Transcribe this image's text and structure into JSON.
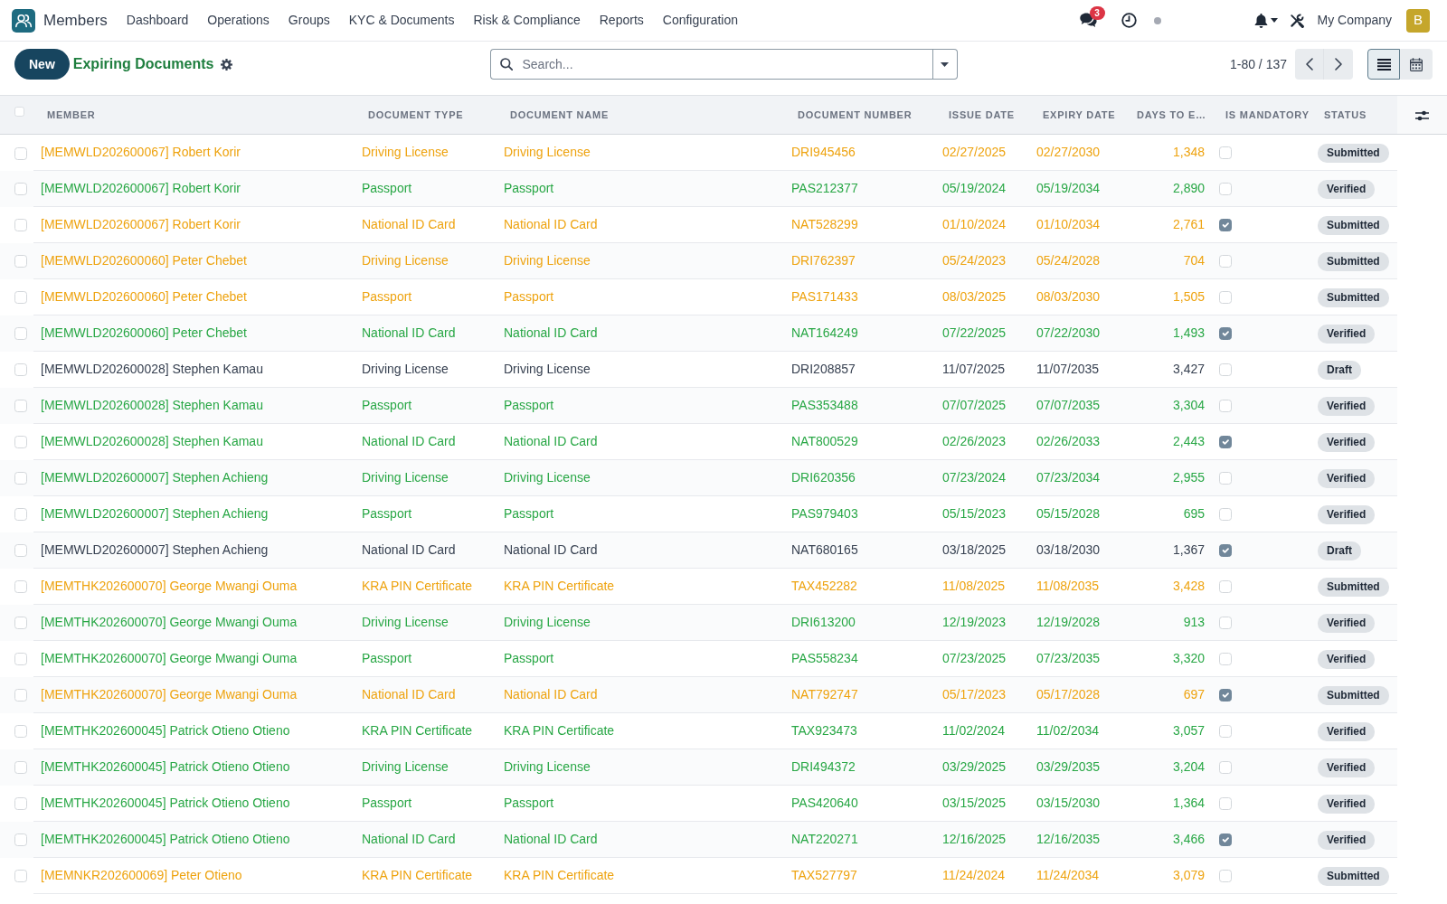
{
  "navbar": {
    "app_name": "Members",
    "menu": [
      "Dashboard",
      "Operations",
      "Groups",
      "KYC & Documents",
      "Risk & Compliance",
      "Reports",
      "Configuration"
    ],
    "unread_messages": "3",
    "company": "My Company",
    "avatar_initial": "B"
  },
  "control_panel": {
    "new_button": "New",
    "title": "Expiring Documents",
    "search": {
      "placeholder": "Search..."
    },
    "pager": "1-80 / 137",
    "views": [
      {
        "kind": "list",
        "selected": true
      },
      {
        "kind": "calendar",
        "selected": false
      }
    ]
  },
  "table": {
    "all_selected": false,
    "columns": [
      "MEMBER",
      "DOCUMENT TYPE",
      "DOCUMENT NAME",
      "DOCUMENT NUMBER",
      "ISSUE DATE",
      "EXPIRY DATE",
      "DAYS TO E…",
      "IS MANDATORY",
      "STATUS"
    ],
    "rows": [
      {
        "selected": false,
        "color": "#eea30f",
        "member": "[MEMWLD202600067] Robert Korir",
        "document_type": "Driving License",
        "document_name": "Driving License",
        "document_number": "DRI945456",
        "issue_date": "02/27/2025",
        "expiry_date": "02/27/2030",
        "days_to_expiry": "1,348",
        "is_mandatory": false,
        "status": "Submitted"
      },
      {
        "selected": false,
        "color": "#28a745",
        "member": "[MEMWLD202600067] Robert Korir",
        "document_type": "Passport",
        "document_name": "Passport",
        "document_number": "PAS212377",
        "issue_date": "05/19/2024",
        "expiry_date": "05/19/2034",
        "days_to_expiry": "2,890",
        "is_mandatory": false,
        "status": "Verified"
      },
      {
        "selected": false,
        "color": "#eea30f",
        "member": "[MEMWLD202600067] Robert Korir",
        "document_type": "National ID Card",
        "document_name": "National ID Card",
        "document_number": "NAT528299",
        "issue_date": "01/10/2024",
        "expiry_date": "01/10/2034",
        "days_to_expiry": "2,761",
        "is_mandatory": true,
        "status": "Submitted"
      },
      {
        "selected": false,
        "color": "#eea30f",
        "member": "[MEMWLD202600060] Peter Chebet",
        "document_type": "Driving License",
        "document_name": "Driving License",
        "document_number": "DRI762397",
        "issue_date": "05/24/2023",
        "expiry_date": "05/24/2028",
        "days_to_expiry": "704",
        "is_mandatory": false,
        "status": "Submitted"
      },
      {
        "selected": false,
        "color": "#eea30f",
        "member": "[MEMWLD202600060] Peter Chebet",
        "document_type": "Passport",
        "document_name": "Passport",
        "document_number": "PAS171433",
        "issue_date": "08/03/2025",
        "expiry_date": "08/03/2030",
        "days_to_expiry": "1,505",
        "is_mandatory": false,
        "status": "Submitted"
      },
      {
        "selected": false,
        "color": "#28a745",
        "member": "[MEMWLD202600060] Peter Chebet",
        "document_type": "National ID Card",
        "document_name": "National ID Card",
        "document_number": "NAT164249",
        "issue_date": "07/22/2025",
        "expiry_date": "07/22/2030",
        "days_to_expiry": "1,493",
        "is_mandatory": true,
        "status": "Verified"
      },
      {
        "selected": false,
        "color": "#374151",
        "member": "[MEMWLD202600028] Stephen Kamau",
        "document_type": "Driving License",
        "document_name": "Driving License",
        "document_number": "DRI208857",
        "issue_date": "11/07/2025",
        "expiry_date": "11/07/2035",
        "days_to_expiry": "3,427",
        "is_mandatory": false,
        "status": "Draft"
      },
      {
        "selected": false,
        "color": "#28a745",
        "member": "[MEMWLD202600028] Stephen Kamau",
        "document_type": "Passport",
        "document_name": "Passport",
        "document_number": "PAS353488",
        "issue_date": "07/07/2025",
        "expiry_date": "07/07/2035",
        "days_to_expiry": "3,304",
        "is_mandatory": false,
        "status": "Verified"
      },
      {
        "selected": false,
        "color": "#28a745",
        "member": "[MEMWLD202600028] Stephen Kamau",
        "document_type": "National ID Card",
        "document_name": "National ID Card",
        "document_number": "NAT800529",
        "issue_date": "02/26/2023",
        "expiry_date": "02/26/2033",
        "days_to_expiry": "2,443",
        "is_mandatory": true,
        "status": "Verified"
      },
      {
        "selected": false,
        "color": "#28a745",
        "member": "[MEMWLD202600007] Stephen Achieng",
        "document_type": "Driving License",
        "document_name": "Driving License",
        "document_number": "DRI620356",
        "issue_date": "07/23/2024",
        "expiry_date": "07/23/2034",
        "days_to_expiry": "2,955",
        "is_mandatory": false,
        "status": "Verified"
      },
      {
        "selected": false,
        "color": "#28a745",
        "member": "[MEMWLD202600007] Stephen Achieng",
        "document_type": "Passport",
        "document_name": "Passport",
        "document_number": "PAS979403",
        "issue_date": "05/15/2023",
        "expiry_date": "05/15/2028",
        "days_to_expiry": "695",
        "is_mandatory": false,
        "status": "Verified"
      },
      {
        "selected": false,
        "color": "#374151",
        "member": "[MEMWLD202600007] Stephen Achieng",
        "document_type": "National ID Card",
        "document_name": "National ID Card",
        "document_number": "NAT680165",
        "issue_date": "03/18/2025",
        "expiry_date": "03/18/2030",
        "days_to_expiry": "1,367",
        "is_mandatory": true,
        "status": "Draft"
      },
      {
        "selected": false,
        "color": "#eea30f",
        "member": "[MEMTHK202600070] George Mwangi Ouma",
        "document_type": "KRA PIN Certificate",
        "document_name": "KRA PIN Certificate",
        "document_number": "TAX452282",
        "issue_date": "11/08/2025",
        "expiry_date": "11/08/2035",
        "days_to_expiry": "3,428",
        "is_mandatory": false,
        "status": "Submitted"
      },
      {
        "selected": false,
        "color": "#28a745",
        "member": "[MEMTHK202600070] George Mwangi Ouma",
        "document_type": "Driving License",
        "document_name": "Driving License",
        "document_number": "DRI613200",
        "issue_date": "12/19/2023",
        "expiry_date": "12/19/2028",
        "days_to_expiry": "913",
        "is_mandatory": false,
        "status": "Verified"
      },
      {
        "selected": false,
        "color": "#28a745",
        "member": "[MEMTHK202600070] George Mwangi Ouma",
        "document_type": "Passport",
        "document_name": "Passport",
        "document_number": "PAS558234",
        "issue_date": "07/23/2025",
        "expiry_date": "07/23/2035",
        "days_to_expiry": "3,320",
        "is_mandatory": false,
        "status": "Verified"
      },
      {
        "selected": false,
        "color": "#eea30f",
        "member": "[MEMTHK202600070] George Mwangi Ouma",
        "document_type": "National ID Card",
        "document_name": "National ID Card",
        "document_number": "NAT792747",
        "issue_date": "05/17/2023",
        "expiry_date": "05/17/2028",
        "days_to_expiry": "697",
        "is_mandatory": true,
        "status": "Submitted"
      },
      {
        "selected": false,
        "color": "#28a745",
        "member": "[MEMTHK202600045] Patrick Otieno Otieno",
        "document_type": "KRA PIN Certificate",
        "document_name": "KRA PIN Certificate",
        "document_number": "TAX923473",
        "issue_date": "11/02/2024",
        "expiry_date": "11/02/2034",
        "days_to_expiry": "3,057",
        "is_mandatory": false,
        "status": "Verified"
      },
      {
        "selected": false,
        "color": "#28a745",
        "member": "[MEMTHK202600045] Patrick Otieno Otieno",
        "document_type": "Driving License",
        "document_name": "Driving License",
        "document_number": "DRI494372",
        "issue_date": "03/29/2025",
        "expiry_date": "03/29/2035",
        "days_to_expiry": "3,204",
        "is_mandatory": false,
        "status": "Verified"
      },
      {
        "selected": false,
        "color": "#28a745",
        "member": "[MEMTHK202600045] Patrick Otieno Otieno",
        "document_type": "Passport",
        "document_name": "Passport",
        "document_number": "PAS420640",
        "issue_date": "03/15/2025",
        "expiry_date": "03/15/2030",
        "days_to_expiry": "1,364",
        "is_mandatory": false,
        "status": "Verified"
      },
      {
        "selected": false,
        "color": "#28a745",
        "member": "[MEMTHK202600045] Patrick Otieno Otieno",
        "document_type": "National ID Card",
        "document_name": "National ID Card",
        "document_number": "NAT220271",
        "issue_date": "12/16/2025",
        "expiry_date": "12/16/2035",
        "days_to_expiry": "3,466",
        "is_mandatory": true,
        "status": "Verified"
      },
      {
        "selected": false,
        "color": "#eea30f",
        "member": "[MEMNKR202600069] Peter Otieno",
        "document_type": "KRA PIN Certificate",
        "document_name": "KRA PIN Certificate",
        "document_number": "TAX527797",
        "issue_date": "11/24/2024",
        "expiry_date": "11/24/2034",
        "days_to_expiry": "3,079",
        "is_mandatory": false,
        "status": "Submitted"
      }
    ]
  }
}
